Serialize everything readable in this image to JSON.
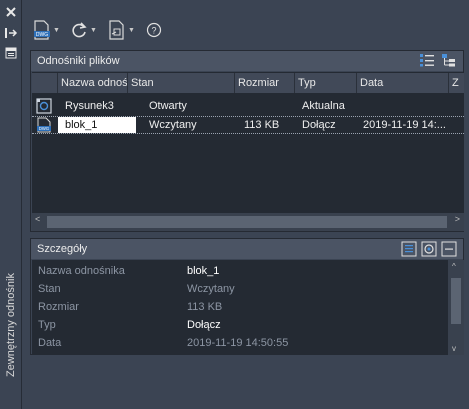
{
  "palette": {
    "window_bg": "#2b3240",
    "panel_bg": "#3b4453",
    "grid_bg": "#242a33",
    "header_bg": "#4b5464",
    "selection_bg": "#ffffff",
    "dim_text": "#8c95a3"
  },
  "window": {
    "title": "Zewnętrzny odnośnik"
  },
  "toolbar": {
    "attach_dwg_icon": "dwg-attach-icon",
    "refresh_icon": "refresh-icon",
    "change_path_icon": "change-path-icon",
    "help_icon": "help-icon"
  },
  "file_refs": {
    "title": "Odnośniki plików",
    "list_view_icon": "list-view-icon",
    "tree_view_icon": "tree-view-icon",
    "columns": [
      "Nazwa odnośnika",
      "Stan",
      "Rozmiar",
      "Typ",
      "Data",
      "Z"
    ],
    "rows": [
      {
        "icon": "drawing-icon",
        "name": "Rysunek3",
        "status": "Otwarty",
        "size": "",
        "type": "Aktualna",
        "date": ""
      },
      {
        "icon": "dwg-file-icon",
        "name": "blok_1",
        "status": "Wczytany",
        "size": "113 KB",
        "type": "Dołącz",
        "date": "2019-11-19 14:..."
      }
    ]
  },
  "details": {
    "title": "Szczegóły",
    "fields": [
      {
        "label": "Nazwa odnośnika",
        "value": "blok_1"
      },
      {
        "label": "Stan",
        "value": "Wczytany"
      },
      {
        "label": "Rozmiar",
        "value": "113 KB"
      },
      {
        "label": "Typ",
        "value": "Dołącz"
      },
      {
        "label": "Data",
        "value": "2019-11-19 14:50:55"
      }
    ]
  }
}
